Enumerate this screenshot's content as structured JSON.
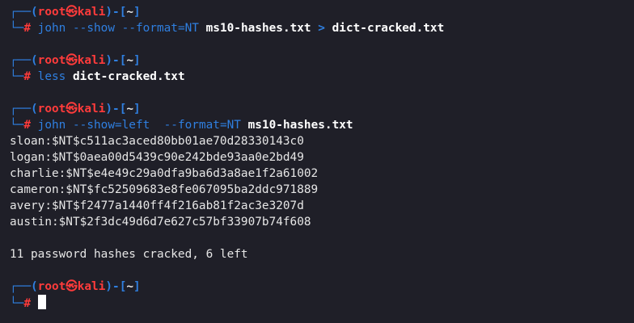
{
  "colors": {
    "background": "#1f1f28",
    "frame": "#2f7fe0",
    "root": "#ff3b3b",
    "command": "#2f7fe0",
    "output": "#e6e6e6"
  },
  "prompt": {
    "frame_top_left": "┌──(",
    "user": "root",
    "skull": "㉿",
    "host": "kali",
    "frame_mid": ")-[",
    "cwd": "~",
    "frame_end": "]",
    "frame_bottom": "└─",
    "hash": "#"
  },
  "blocks": [
    {
      "command": "john",
      "args": [
        {
          "text": "--show",
          "type": "opt"
        },
        {
          "text": "--format=NT",
          "type": "opt"
        },
        {
          "text": "ms10-hashes.txt",
          "type": "file"
        },
        {
          "text": ">",
          "type": "redir"
        },
        {
          "text": "dict-cracked.txt",
          "type": "file"
        }
      ],
      "output": []
    },
    {
      "command": "less",
      "args": [
        {
          "text": "dict-cracked.txt",
          "type": "file"
        }
      ],
      "output": []
    },
    {
      "command": "john",
      "args": [
        {
          "text": "--show=left ",
          "type": "opt"
        },
        {
          "text": "--format=NT",
          "type": "opt"
        },
        {
          "text": "ms10-hashes.txt",
          "type": "file"
        }
      ],
      "output": [
        "sloan:$NT$c511ac3aced80bb01ae70d28330143c0",
        "logan:$NT$0aea00d5439c90e242bde93aa0e2bd49",
        "charlie:$NT$e4e49c29a0dfa9ba6d3a8ae1f2a61002",
        "cameron:$NT$fc52509683e8fe067095ba2ddc971889",
        "avery:$NT$f2477a1440ff4f216ab81f2ac3e3207d",
        "austin:$NT$2f3dc49d6d7e627c57bf33907b74f608",
        "",
        "11 password hashes cracked, 6 left"
      ]
    }
  ],
  "final_prompt": {
    "input": ""
  }
}
